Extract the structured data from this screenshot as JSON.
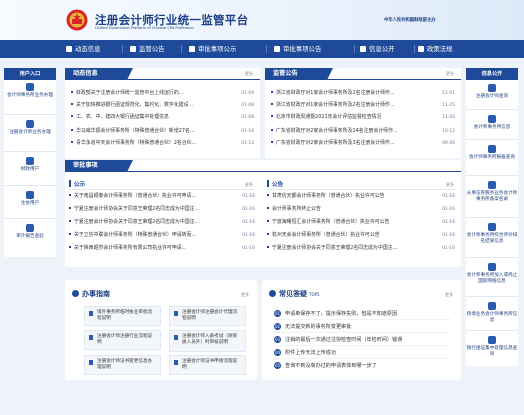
{
  "header": {
    "title_cn": "注册会计师行业统一监管平台",
    "title_en": "Unified Supervision Platform of Chinese CPA Profession",
    "sponsor": "中华人民共和国财政部主办"
  },
  "nav": [
    {
      "label": "动态信息"
    },
    {
      "label": "监管公告"
    },
    {
      "label": "审批事项公示"
    },
    {
      "label": "审批事项公告"
    },
    {
      "label": "信息公开"
    },
    {
      "label": "政策法规"
    }
  ],
  "left_sidebar": {
    "title": "用户入口",
    "items": [
      {
        "label": "会计师事务所业务办理",
        "icon": "building-icon"
      },
      {
        "label": "注册会计师业务办理",
        "icon": "person-icon"
      },
      {
        "label": "财政用户",
        "icon": "users-icon"
      },
      {
        "label": "注协用户",
        "icon": "group-icon"
      },
      {
        "label": "审计报告查验",
        "icon": "shield-icon"
      }
    ]
  },
  "right_sidebar": {
    "title": "信息公开",
    "items": [
      {
        "label": "注册会计师查询",
        "icon": "person-search-icon"
      },
      {
        "label": "会计师事务所信息",
        "icon": "list-icon"
      },
      {
        "label": "会计师事务所报备查询",
        "icon": "document-icon"
      },
      {
        "label": "从事证券服务业务会计师事务所备案名录",
        "icon": "grid-icon"
      },
      {
        "label": "会计师事务所综合评价排名结果信息",
        "icon": "chart-icon"
      },
      {
        "label": "会计师事务所加入或终止国际网络信息",
        "icon": "globe-icon"
      },
      {
        "label": "跨境业务会计师事务所信息",
        "icon": "exchange-icon"
      },
      {
        "label": "银行函证集中处理信息查询",
        "icon": "bank-icon"
      }
    ]
  },
  "dynamic_info": {
    "title": "动态信息",
    "more": "更多",
    "items": [
      {
        "text": "财政部关于注册会计师统一监管平台上线运行的...",
        "date": "01-09"
      },
      {
        "text": "关于加快推进银行函证规范化、集约化、数字化建设...",
        "date": "01-08"
      },
      {
        "text": "工、农、中、建四大银行函证集中处理信息",
        "date": "01-08"
      },
      {
        "text": "华马威华振会计师事务所（特殊普通合伙）新增27名...",
        "date": "01-16"
      },
      {
        "text": "青华永道中天会计师事务所（特殊普通合伙）2名合伙...",
        "date": "01-12"
      }
    ]
  },
  "supervision": {
    "title": "监管公告",
    "more": "更多",
    "items": [
      {
        "text": "浙江省财政厅对1家会计师事务所及2名注册会计师作...",
        "date": "12-01"
      },
      {
        "text": "浙江省财政厅对1家会计师事务所及2名注册会计师作...",
        "date": "11-25"
      },
      {
        "text": "北京市财政局通报2021年会计评估监督检查情况",
        "date": "11-20"
      },
      {
        "text": "广东省财政厅对2家会计师事务所及14名注册会计师作...",
        "date": "10-12"
      },
      {
        "text": "广东省财政厅对2家会计师事务所及3名注册会计师作...",
        "date": "09-26"
      }
    ]
  },
  "approval": {
    "title": "审批事项",
    "public": {
      "title": "公示",
      "more": "更多",
      "items": [
        {
          "text": "关于南昌顺泰会计师事务所（普通合伙）执业许可申请...",
          "date": "01-16"
        },
        {
          "text": "宁夏注册会计师协会关于同意王荣理2名同志成为中国注...",
          "date": "01-16"
        },
        {
          "text": "宁夏注册会计师协会关于同意王荣理2名同志成为中国注...",
          "date": "01-16"
        },
        {
          "text": "关于立信中联会计师事务所（特殊普通合伙）申请转而...",
          "date": "01-16"
        },
        {
          "text": "关于陕西昭然会计师事务所有限公司执业许可申请...",
          "date": "01-16"
        }
      ]
    },
    "announce": {
      "title": "公告",
      "more": "更多",
      "items": [
        {
          "text": "甘肃信天都会计师事务所（普通合伙）执业许可公告",
          "date": "01-16"
        },
        {
          "text": "会计师事务所终止公告",
          "date": "01-16"
        },
        {
          "text": "宁波海曙恒汇会计师事务所（普通合伙）执业许可公告",
          "date": "01-16"
        },
        {
          "text": "杭州天会会计师事务所（普通合伙）执业许可公告",
          "date": "01-16"
        },
        {
          "text": "宁夏注册会计师协会关于同意王荣理2名同志成为中国注...",
          "date": "01-16"
        }
      ]
    }
  },
  "guide": {
    "title": "办事指南",
    "more": "更多",
    "items": [
      {
        "label": "境外事务所临时执业审批流程说明"
      },
      {
        "label": "注册会计师注册会计代理流程说明"
      },
      {
        "label": "注册会计师注册行业流程说明"
      },
      {
        "label": "注册会计师入备考试（除资质人员外）时审核说明"
      },
      {
        "label": "注册会计师证书变更信息办理说明"
      },
      {
        "label": "注册会计师证书申请流程说明"
      }
    ]
  },
  "faq": {
    "title": "常见答疑",
    "subtitle": "TOP5",
    "more": "更多",
    "items": [
      {
        "num": "01",
        "text": "申请单保存不了，提示保存失败，但是不知道原因"
      },
      {
        "num": "02",
        "text": "无法提交新的事务所变更审批"
      },
      {
        "num": "03",
        "text": "注销的最后一次通过注协检查时间（年检时间）错误"
      },
      {
        "num": "04",
        "text": "附件上传无法上传成功"
      },
      {
        "num": "05",
        "text": "查询不到没有办过的申请表体到哪一步了"
      }
    ]
  },
  "colors": {
    "primary": "#1f4a9a",
    "background": "#eef3fa"
  }
}
